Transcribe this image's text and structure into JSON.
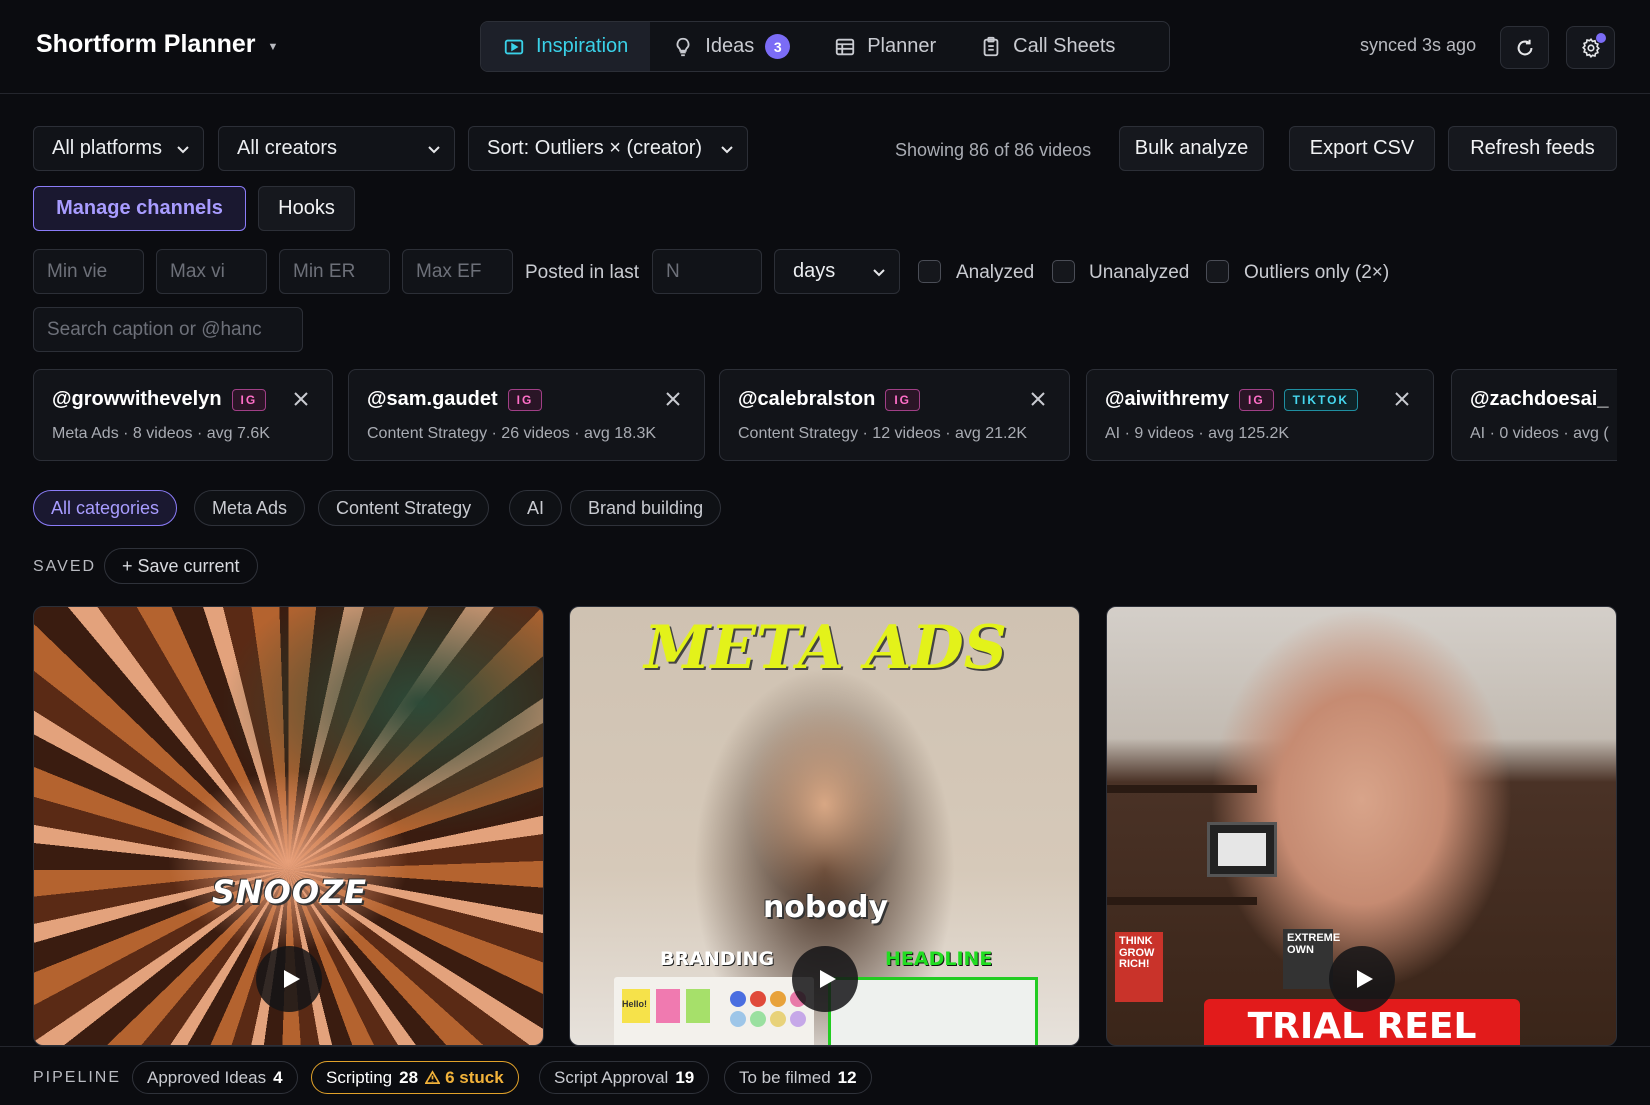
{
  "app": {
    "title": "Shortform Planner"
  },
  "tabs": [
    {
      "label": "Inspiration",
      "icon": "play-square-icon",
      "active": true
    },
    {
      "label": "Ideas",
      "icon": "lightbulb-icon",
      "badge": "3"
    },
    {
      "label": "Planner",
      "icon": "table-icon"
    },
    {
      "label": "Call Sheets",
      "icon": "clipboard-icon"
    }
  ],
  "sync": {
    "text": "synced 3s ago"
  },
  "filters": {
    "platform": "All platforms",
    "creator": "All creators",
    "sort": "Sort: Outliers × (creator)",
    "showing": "Showing 86 of 86 videos",
    "bulk_analyze": "Bulk analyze",
    "export_csv": "Export CSV",
    "refresh_feeds": "Refresh feeds",
    "manage_channels": "Manage channels",
    "hooks": "Hooks",
    "min_views_placeholder": "Min vie",
    "max_views_placeholder": "Max vi",
    "min_er_placeholder": "Min ER",
    "max_er_placeholder": "Max EF",
    "posted_in_last": "Posted in last",
    "n_placeholder": "N",
    "days": "days",
    "analyzed": "Analyzed",
    "unanalyzed": "Unanalyzed",
    "outliers_only": "Outliers only (2×)",
    "search_placeholder": "Search caption or @hanc"
  },
  "channels": [
    {
      "handle": "@growwithevelyn",
      "tags": [
        "IG"
      ],
      "meta": "Meta Ads · 8 videos · avg 7.6K"
    },
    {
      "handle": "@sam.gaudet",
      "tags": [
        "IG"
      ],
      "meta": "Content Strategy · 26 videos · avg 18.3K"
    },
    {
      "handle": "@calebralston",
      "tags": [
        "IG"
      ],
      "meta": "Content Strategy · 12 videos · avg 21.2K"
    },
    {
      "handle": "@aiwithremy",
      "tags": [
        "IG",
        "TIKTOK"
      ],
      "meta": "AI · 9 videos · avg 125.2K"
    },
    {
      "handle": "@zachdoesai_",
      "tags": [],
      "meta": "AI · 0 videos · avg ("
    }
  ],
  "categories": [
    "All categories",
    "Meta Ads",
    "Content Strategy",
    "AI",
    "Brand building"
  ],
  "saved": {
    "label": "SAVED",
    "save_current": "+ Save current"
  },
  "videos": [
    {
      "overlay": "SNOOZE"
    },
    {
      "overlay_top": "META ADS",
      "overlay_mid": "nobody",
      "label_left": "BRANDING",
      "label_right": "HEADLINE",
      "sticky_text": "Hello!"
    },
    {
      "overlay": "TRIAL REEL",
      "book_text": "THINK GROW RICH!",
      "book2_text": "EXTREME OWN"
    }
  ],
  "pipeline": {
    "label": "PIPELINE",
    "stages": [
      {
        "name": "Approved Ideas",
        "count": "4"
      },
      {
        "name": "Scripting",
        "count": "28",
        "stuck": "6 stuck"
      },
      {
        "name": "Script Approval",
        "count": "19"
      },
      {
        "name": "To be filmed",
        "count": "12"
      }
    ]
  },
  "colors": {
    "accent": "#3ad1e8",
    "purple": "#7b6cf6",
    "warning": "#e0a12a",
    "ig": "#ff6fc8",
    "tiktok": "#46d8ef"
  }
}
